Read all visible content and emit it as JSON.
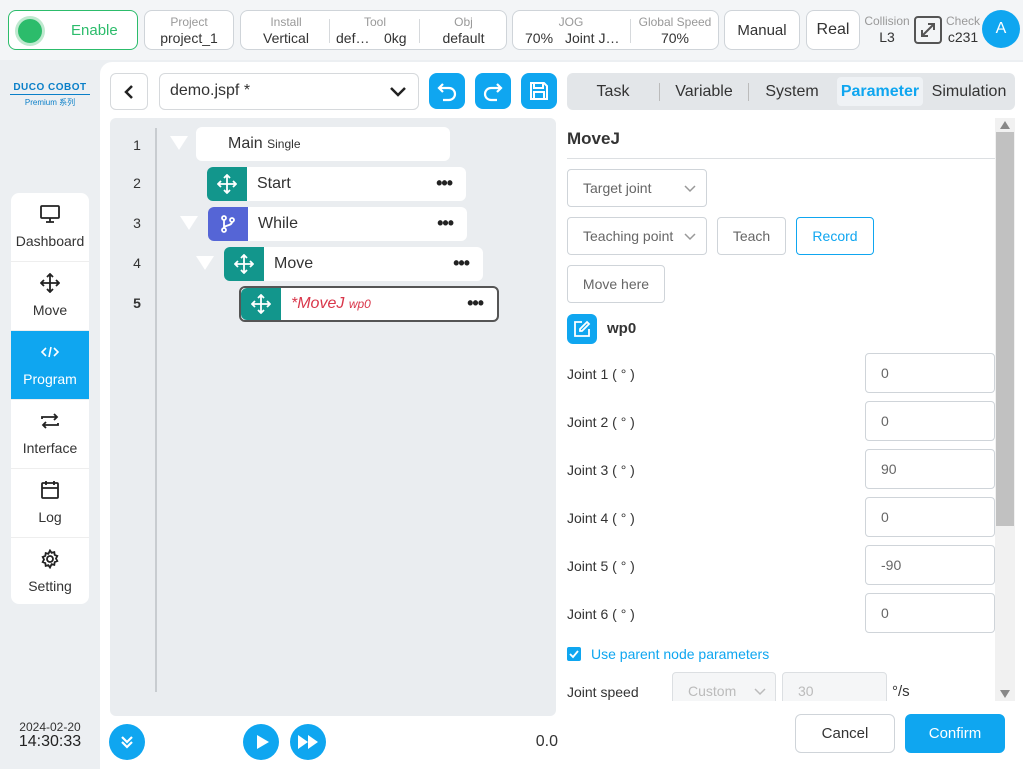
{
  "topbar": {
    "enable_label": "Enable",
    "project": {
      "label": "Project",
      "value": "project_1"
    },
    "install": {
      "label": "Install",
      "value": "Vertical"
    },
    "tool": {
      "label": "Tool",
      "name": "def…",
      "weight": "0kg"
    },
    "obj": {
      "label": "Obj",
      "value": "default"
    },
    "jog": {
      "label": "JOG",
      "percent": "70%",
      "mode": "Joint J…"
    },
    "global_speed": {
      "label": "Global Speed",
      "value": "70%"
    },
    "mode_button": "Manual",
    "real_button": "Real",
    "collision": {
      "label": "Collision",
      "value": "L3"
    },
    "check": {
      "label": "Check",
      "value": "c231"
    },
    "avatar": "A",
    "colors": {
      "accent": "#0fa6f0",
      "enable_green": "#2cbc6b"
    }
  },
  "logo": {
    "brand": "DUCO COBOT",
    "sub": "Premium 系列"
  },
  "sidebar": {
    "items": [
      {
        "label": "Dashboard",
        "icon": "monitor-icon"
      },
      {
        "label": "Move",
        "icon": "move-arrows-icon"
      },
      {
        "label": "Program",
        "icon": "code-icon"
      },
      {
        "label": "Interface",
        "icon": "swap-icon"
      },
      {
        "label": "Log",
        "icon": "calendar-icon"
      },
      {
        "label": "Setting",
        "icon": "gear-icon"
      }
    ]
  },
  "datetime": {
    "date": "2024-02-20",
    "time": "14:30:33"
  },
  "file": {
    "name": "demo.jspf *"
  },
  "tree": {
    "line_numbers": [
      "1",
      "2",
      "3",
      "4",
      "5"
    ],
    "nodes": [
      {
        "title": "Main",
        "subtitle": "Single"
      },
      {
        "title": "Start"
      },
      {
        "title": "While"
      },
      {
        "title": "Move"
      },
      {
        "title": "*MoveJ",
        "subtitle": "wp0"
      }
    ]
  },
  "tabs": [
    "Task",
    "Variable",
    "System",
    "Parameter",
    "Simulation"
  ],
  "param": {
    "title": "MoveJ",
    "target_select": "Target joint",
    "teaching_select": "Teaching point",
    "teach_button": "Teach",
    "record_button": "Record",
    "move_here_button": "Move here",
    "waypoint": "wp0",
    "joints": [
      {
        "label": "Joint 1 ( ° )",
        "value": "0"
      },
      {
        "label": "Joint 2 ( ° )",
        "value": "0"
      },
      {
        "label": "Joint 3 ( ° )",
        "value": "90"
      },
      {
        "label": "Joint 4 ( ° )",
        "value": "0"
      },
      {
        "label": "Joint 5 ( ° )",
        "value": "-90"
      },
      {
        "label": "Joint 6 ( ° )",
        "value": "0"
      }
    ],
    "use_parent_label": "Use parent node parameters",
    "use_parent_checked": true,
    "joint_speed": {
      "label": "Joint speed",
      "mode": "Custom",
      "value": "30",
      "unit": "°/s"
    }
  },
  "footer": {
    "time_value": "0.0",
    "cancel": "Cancel",
    "confirm": "Confirm"
  }
}
